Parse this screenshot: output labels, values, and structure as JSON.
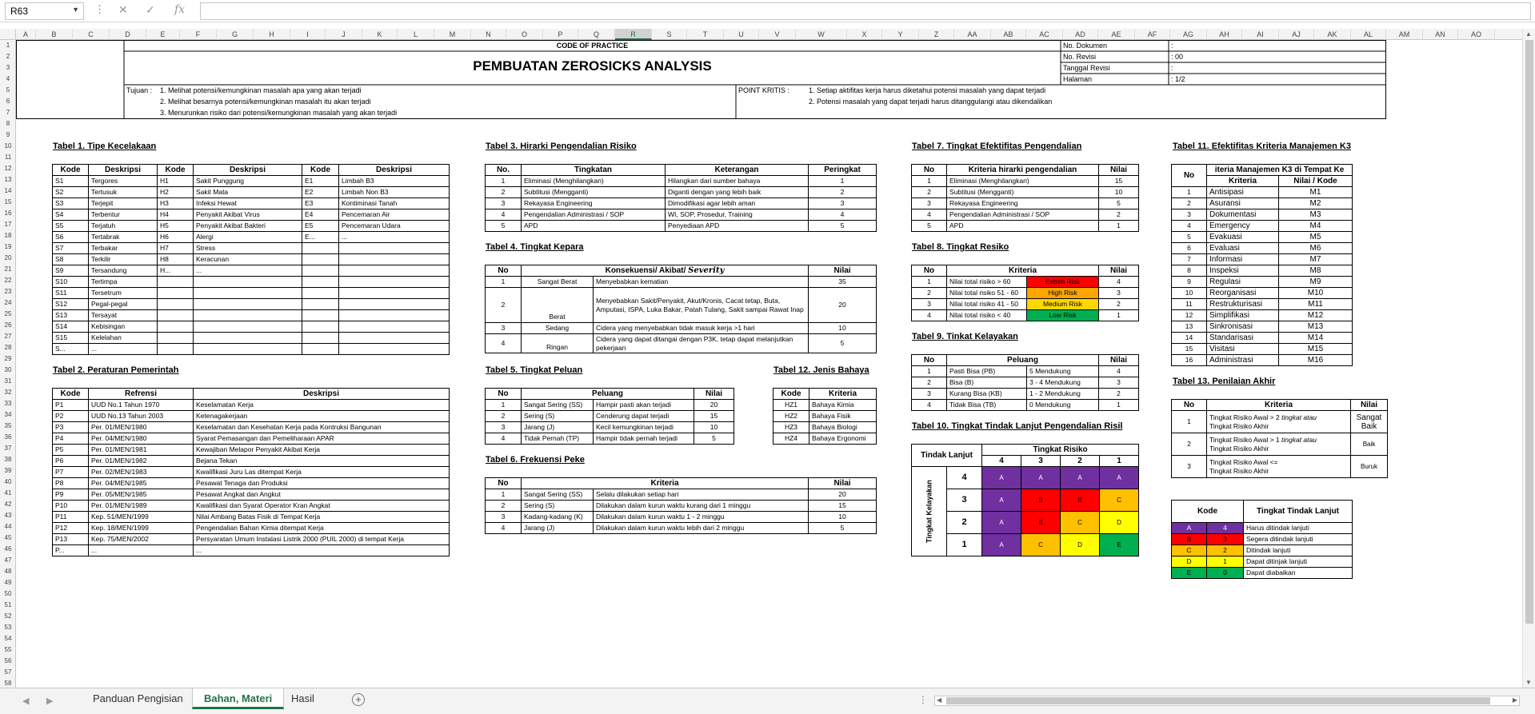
{
  "formula_bar": {
    "cell_ref": "R63",
    "fx_label": "fx",
    "formula": ""
  },
  "sheet_tabs": [
    {
      "label": "Panduan Pengisian",
      "active": false
    },
    {
      "label": "Bahan, Materi",
      "active": true
    },
    {
      "label": "Hasil",
      "active": false
    }
  ],
  "selected_column": "R",
  "column_headers": [
    {
      "label": "A",
      "w": 25
    },
    {
      "label": "B",
      "w": 46
    },
    {
      "label": "C",
      "w": 46
    },
    {
      "label": "D",
      "w": 46
    },
    {
      "label": "E",
      "w": 42
    },
    {
      "label": "F",
      "w": 46
    },
    {
      "label": "G",
      "w": 46
    },
    {
      "label": "H",
      "w": 46
    },
    {
      "label": "I",
      "w": 44
    },
    {
      "label": "J",
      "w": 46
    },
    {
      "label": "K",
      "w": 44
    },
    {
      "label": "L",
      "w": 46
    },
    {
      "label": "M",
      "w": 46
    },
    {
      "label": "N",
      "w": 44
    },
    {
      "label": "O",
      "w": 46
    },
    {
      "label": "P",
      "w": 44
    },
    {
      "label": "Q",
      "w": 46
    },
    {
      "label": "R",
      "w": 46
    },
    {
      "label": "S",
      "w": 44
    },
    {
      "label": "T",
      "w": 46
    },
    {
      "label": "U",
      "w": 44
    },
    {
      "label": "V",
      "w": 46
    },
    {
      "label": "W",
      "w": 64
    },
    {
      "label": "X",
      "w": 44
    },
    {
      "label": "Y",
      "w": 46
    },
    {
      "label": "Z",
      "w": 44
    },
    {
      "label": "AA",
      "w": 46
    },
    {
      "label": "AB",
      "w": 44
    },
    {
      "label": "AC",
      "w": 46
    },
    {
      "label": "AD",
      "w": 44
    },
    {
      "label": "AE",
      "w": 46
    },
    {
      "label": "AF",
      "w": 44
    },
    {
      "label": "AG",
      "w": 46
    },
    {
      "label": "AH",
      "w": 44
    },
    {
      "label": "AI",
      "w": 46
    },
    {
      "label": "AJ",
      "w": 44
    },
    {
      "label": "AK",
      "w": 46
    },
    {
      "label": "AL",
      "w": 44
    },
    {
      "label": "AM",
      "w": 46
    },
    {
      "label": "AN",
      "w": 44
    },
    {
      "label": "AO",
      "w": 46
    }
  ],
  "row_count": 58,
  "header_block": {
    "code_of_practice": "CODE OF PRACTICE",
    "title": "PEMBUATAN ZEROSICKS ANALYSIS",
    "tujuan_label": "Tujuan :",
    "tujuan": [
      "1. Melihat potensi/kemungkinan masalah apa yang akan terjadi",
      "2. Melihat besarnya potensi/kemungkinan masalah itu akan terjadi",
      "3. Menurunkan risiko dari potensi/kemungkinan masalah yang akan terjadi"
    ],
    "point_kritis_label": "POINT KRITIS :",
    "point_kritis": [
      "1. Setiap aktifitas kerja harus diketahui potensi masalah yang dapat terjadi",
      "2. Potensi masalah yang dapat terjadi harus ditanggulangi atau dikendalikan"
    ],
    "doc_info": [
      {
        "label": "No. Dokumen",
        "value": ":"
      },
      {
        "label": "No. Revisi",
        "value": ": 00"
      },
      {
        "label": "Tanggal Revisi",
        "value": ":"
      },
      {
        "label": "Halaman",
        "value": ": 1/2"
      }
    ]
  },
  "t1": {
    "title": "Tabel 1. Tipe Kecelakaan",
    "headers": [
      "Kode",
      "Deskripsi",
      "Kode",
      "Deskripsi",
      "Kode",
      "Deskripsi"
    ],
    "rows": [
      [
        "S1",
        "Tergores",
        "H1",
        "Sakit Punggung",
        "E1",
        "Limbah B3"
      ],
      [
        "S2",
        "Tertusuk",
        "H2",
        "Sakit Mata",
        "E2",
        "Limbah Non B3"
      ],
      [
        "S3",
        "Terjepit",
        "H3",
        "Infeksi Hewat",
        "E3",
        "Kontiminasi Tanah"
      ],
      [
        "S4",
        "Terbentur",
        "H4",
        "Penyakit Akibat Virus",
        "E4",
        "Pencemaran Air"
      ],
      [
        "S5",
        "Terjatuh",
        "H5",
        "Penyakit Akibat Bakteri",
        "E5",
        "Pencemaran Udara"
      ],
      [
        "S6",
        "Tertabrak",
        "H6",
        "Alergi",
        "E...",
        "..."
      ],
      [
        "S7",
        "Terbakar",
        "H7",
        "Stress",
        "",
        ""
      ],
      [
        "S8",
        "Terkilir",
        "H8",
        "Keracunan",
        "",
        ""
      ],
      [
        "S9",
        "Tersandung",
        "H...",
        "...",
        "",
        ""
      ],
      [
        "S10",
        "Tertimpa",
        "",
        "",
        "",
        ""
      ],
      [
        "S11",
        "Tersetrum",
        "",
        "",
        "",
        ""
      ],
      [
        "S12",
        "Pegal-pegal",
        "",
        "",
        "",
        ""
      ],
      [
        "S13",
        "Tersayat",
        "",
        "",
        "",
        ""
      ],
      [
        "S14",
        "Kebisingan",
        "",
        "",
        "",
        ""
      ],
      [
        "S15",
        "Kelelahan",
        "",
        "",
        "",
        ""
      ],
      [
        "S...",
        "...",
        "",
        "",
        "",
        ""
      ]
    ]
  },
  "t2": {
    "title": "Tabel 2. Peraturan Pemerintah",
    "headers": [
      "Kode",
      "Refrensi",
      "Deskripsi"
    ],
    "rows": [
      [
        "P1",
        "UUD No.1 Tahun 1970",
        "Keselamatan Kerja"
      ],
      [
        "P2",
        "UUD No.13 Tahun 2003",
        "Ketenagakerjaan"
      ],
      [
        "P3",
        "Per. 01/MEN/1980",
        "Keselamatan dan Kesehatan Kerja pada Kontruksi Bangunan"
      ],
      [
        "P4",
        "Per. 04/MEN/1980",
        "Syarat Pemasangan dan Pemeliharaan APAR"
      ],
      [
        "P5",
        "Per. 01/MEN/1981",
        "Kewajiban Melapor Penyakit Akibat Kerja"
      ],
      [
        "P6",
        "Per. 01/MEN/1982",
        "Bejana Tekan"
      ],
      [
        "P7",
        "Per. 02/MEN/1983",
        "Kwalifikasi Juru Las ditempat Kerja"
      ],
      [
        "P8",
        "Per. 04/MEN/1985",
        "Pesawat Tenaga dan Produksi"
      ],
      [
        "P9",
        "Per. 05/MEN/1985",
        "Pesawat Angkat dan Angkut"
      ],
      [
        "P10",
        "Per. 01/MEN/1989",
        "Kwalifikasi dan Syarat Operator Kran Angkat"
      ],
      [
        "P11",
        "Kep. 51/MEN/1999",
        "Nilai Ambang Batas Fisik di Tempat Kerja"
      ],
      [
        "P12",
        "Kep. 18/MEN/1999",
        "Pengendalian Bahan Kimia ditempat Kerja"
      ],
      [
        "P13",
        "Kep. 75/MEN/2002",
        "Persyaratan Umum Instalasi Listrik 2000 (PUIL 2000) di tempat Kerja"
      ],
      [
        "P...",
        "...",
        "..."
      ]
    ]
  },
  "t3": {
    "title": "Tabel 3. Hirarki Pengendalian Risiko",
    "headers": [
      "No.",
      "Tingkatan",
      "Keterangan",
      "Peringkat"
    ],
    "rows": [
      [
        "1",
        "Eliminasi (Menghilangkan)",
        "Hilangkan dari sumber bahaya",
        "1"
      ],
      [
        "2",
        "Subtitusi (Mengganti)",
        "Diganti dengan yang lebih baik",
        "2"
      ],
      [
        "3",
        "Rekayasa Engineering",
        "Dimodifikasi agar lebih aman",
        "3"
      ],
      [
        "4",
        "Pengendalian Administrasi / SOP",
        "WI, SOP, Prosedur, Training",
        "4"
      ],
      [
        "5",
        "APD",
        "Penyediaan APD",
        "5"
      ]
    ]
  },
  "t4": {
    "title": "Tabel 4. Tingkat Kepara",
    "headers": [
      "No",
      "Konsekuensi/ Akibat/",
      "Severity",
      "Nilai"
    ],
    "rows": [
      [
        "1",
        "Sangat Berat",
        "Menyebabkan kematian",
        "35"
      ],
      [
        "2",
        "Berat",
        "Menyebabkan Sakit/Penyakit, Akut/Kronis, Cacat tetap, Buta, Amputasi, ISPA, Luka Bakar, Patah Tulang, Sakit sampai Rawat Inap",
        "20"
      ],
      [
        "3",
        "Sedang",
        "Cidera yang menyebabkan tidak masuk kerja >1 hari",
        "10"
      ],
      [
        "4",
        "Ringan",
        "Cidera yang dapat ditangai dengan P3K, tetap dapat melanjutkan pekerjaan",
        "5"
      ]
    ]
  },
  "t5": {
    "title": "Tabel 5. Tingkat Peluan",
    "headers": [
      "No",
      "Peluang",
      "Nilai"
    ],
    "rows": [
      [
        "1",
        "Sangat Sering (SS)",
        "Hampir pasti akan terjadi",
        "20"
      ],
      [
        "2",
        "Sering (S)",
        "Cenderung dapat terjadi",
        "15"
      ],
      [
        "3",
        "Jarang (J)",
        "Kecil kemungkinan terjadi",
        "10"
      ],
      [
        "4",
        "Tidak Pernah (TP)",
        "Hampir tidak pernah terjadi",
        "5"
      ]
    ]
  },
  "t6": {
    "title": "Tabel 6. Frekuensi Peke",
    "headers": [
      "No",
      "Kriteria",
      "Nilai"
    ],
    "rows": [
      [
        "1",
        "Sangat Sering (SS)",
        "Selalu dilakukan setiap hari",
        "20"
      ],
      [
        "2",
        "Sering (S)",
        "Dilakukan dalam kurun waktu kurang dari 1 minggu",
        "15"
      ],
      [
        "3",
        "Kadang-kadang (K)",
        "Dilakukan dalam kurun waktu 1 - 2 minggu",
        "10"
      ],
      [
        "4",
        "Jarang (J)",
        "Dilakukan dalam kurun waktu lebih dari 2 minggu",
        "5"
      ]
    ]
  },
  "t7": {
    "title": "Tabel 7. Tingkat Efektifitas Pengendalian",
    "headers": [
      "No",
      "Kriteria hirarki pengendalian",
      "Nilai"
    ],
    "rows": [
      [
        "1",
        "Eliminasi (Menghilangkan)",
        "15"
      ],
      [
        "2",
        "Subtitusi (Mengganti)",
        "10"
      ],
      [
        "3",
        "Rekayasa Engineering",
        "5"
      ],
      [
        "4",
        "Pengendalian Administrasi / SOP",
        "2"
      ],
      [
        "5",
        "APD",
        "1"
      ]
    ]
  },
  "t8": {
    "title": "Tabel 8. Tingkat Resiko",
    "headers": [
      "No",
      "Kriteria",
      "Nilai"
    ],
    "rows": [
      [
        "1",
        "Nilai total risiko > 60",
        "Extrim Risk",
        "4"
      ],
      [
        "2",
        "Nilai total risiko 51 - 60",
        "High Risk",
        "3"
      ],
      [
        "3",
        "Nilai total risiko 41 - 50",
        "Medium Risk",
        "2"
      ],
      [
        "4",
        "Nilai total risiko < 40",
        "Low Risk",
        "1"
      ]
    ],
    "colors": {
      "extreme": "#ff0000",
      "high": "#ffa500",
      "medium": "#ffd700",
      "low": "#00b050"
    }
  },
  "t9": {
    "title": "Tabel 9. Tinkat Kelayakan",
    "headers": [
      "No",
      "Peluang",
      "Nilai"
    ],
    "rows": [
      [
        "1",
        "Pasti Bisa (PB)",
        "5 Mendukung",
        "4"
      ],
      [
        "2",
        "Bisa (B)",
        "3 - 4 Mendukung",
        "3"
      ],
      [
        "3",
        "Kurang Bisa (KB)",
        "1 - 2 Mendukung",
        "2"
      ],
      [
        "4",
        "Tidak Bisa (TB)",
        "0 Mendukung",
        "1"
      ]
    ]
  },
  "t10": {
    "title": "Tabel 10. Tingkat Tindak Lanjut Pengendalian Risil",
    "tindak_lanjut": "Tindak Lanjut",
    "tingkat_risiko": "Tingkat Risiko",
    "tingkat_kelayakan": "Tingkat Kelayakan",
    "risk_cols": [
      "4",
      "3",
      "2",
      "1"
    ],
    "rows": [
      {
        "label": "4",
        "cells": [
          "A",
          "A",
          "A",
          "A"
        ]
      },
      {
        "label": "3",
        "cells": [
          "A",
          "B",
          "B",
          "C"
        ]
      },
      {
        "label": "2",
        "cells": [
          "A",
          "B",
          "C",
          "D"
        ]
      },
      {
        "label": "1",
        "cells": [
          "A",
          "C",
          "D",
          "E"
        ]
      }
    ],
    "colors": {
      "A": "#7030a0",
      "B": "#ff0000",
      "C": "#ffc000",
      "D": "#ffff00",
      "E": "#00b050"
    }
  },
  "t11": {
    "title": "Tabel 11. Efektifitas Kriteria Manajemen K3",
    "no_label": "No",
    "group_header": "iteria Manajemen K3 di Tempat Ke",
    "headers": [
      "Kriteria",
      "Nilai / Kode"
    ],
    "rows": [
      [
        "1",
        "Antisipasi",
        "M1"
      ],
      [
        "2",
        "Asuransi",
        "M2"
      ],
      [
        "3",
        "Dokumentasi",
        "M3"
      ],
      [
        "4",
        "Emergency",
        "M4"
      ],
      [
        "5",
        "Evakuasi",
        "M5"
      ],
      [
        "6",
        "Evaluasi",
        "M6"
      ],
      [
        "7",
        "Informasi",
        "M7"
      ],
      [
        "8",
        "Inspeksi",
        "M8"
      ],
      [
        "9",
        "Regulasi",
        "M9"
      ],
      [
        "10",
        "Reorganisasi",
        "M10"
      ],
      [
        "11",
        "Restrukturisasi",
        "M11"
      ],
      [
        "12",
        "Simplifikasi",
        "M12"
      ],
      [
        "13",
        "Sinkronisasi",
        "M13"
      ],
      [
        "14",
        "Standarisasi",
        "M14"
      ],
      [
        "15",
        "Visitasi",
        "M15"
      ],
      [
        "16",
        "Administrasi",
        "M16"
      ]
    ]
  },
  "t12": {
    "title": "Tabel 12. Jenis Bahaya",
    "headers": [
      "Kode",
      "Kriteria"
    ],
    "rows": [
      [
        "HZ1",
        "Bahaya Kimia"
      ],
      [
        "HZ2",
        "Bahaya Fisik"
      ],
      [
        "HZ3",
        "Bahaya Biologi"
      ],
      [
        "HZ4",
        "Bahaya Ergonomi"
      ]
    ]
  },
  "t13": {
    "title": "Tabel 13. Penilaian Akhir",
    "headers": [
      "No",
      "Kriteria",
      "Nilai"
    ],
    "rows": [
      {
        "no": "1",
        "l1a": "Tingkat Risiko Awal > 2",
        "l1b": "tingkat atau",
        "l2": "Tingkat Risiko Akhir",
        "nilai": "Sangat Baik"
      },
      {
        "no": "2",
        "l1a": "Tingkat Risiko Awal > 1",
        "l1b": "tingkat atau",
        "l2": "Tingkat Risiko Akhir",
        "nilai": "Baik"
      },
      {
        "no": "3",
        "l1a": "Tingkat Risiko Awal <=",
        "l1b": "",
        "l2": "Tingkat Risiko Akhir",
        "nilai": "Buruk"
      }
    ]
  },
  "legend": {
    "headers": [
      "Kode",
      "Tingkat Tindak Lanjut"
    ],
    "rows": [
      [
        "A",
        "4",
        "Harus ditindak lanjuti"
      ],
      [
        "B",
        "3",
        "Segera ditindak lanjuti"
      ],
      [
        "C",
        "2",
        "Ditindak lanjuti"
      ],
      [
        "D",
        "1",
        "Dapat ditinjak lanjuti"
      ],
      [
        "E",
        "0",
        "Dapat diabaikan"
      ]
    ]
  }
}
